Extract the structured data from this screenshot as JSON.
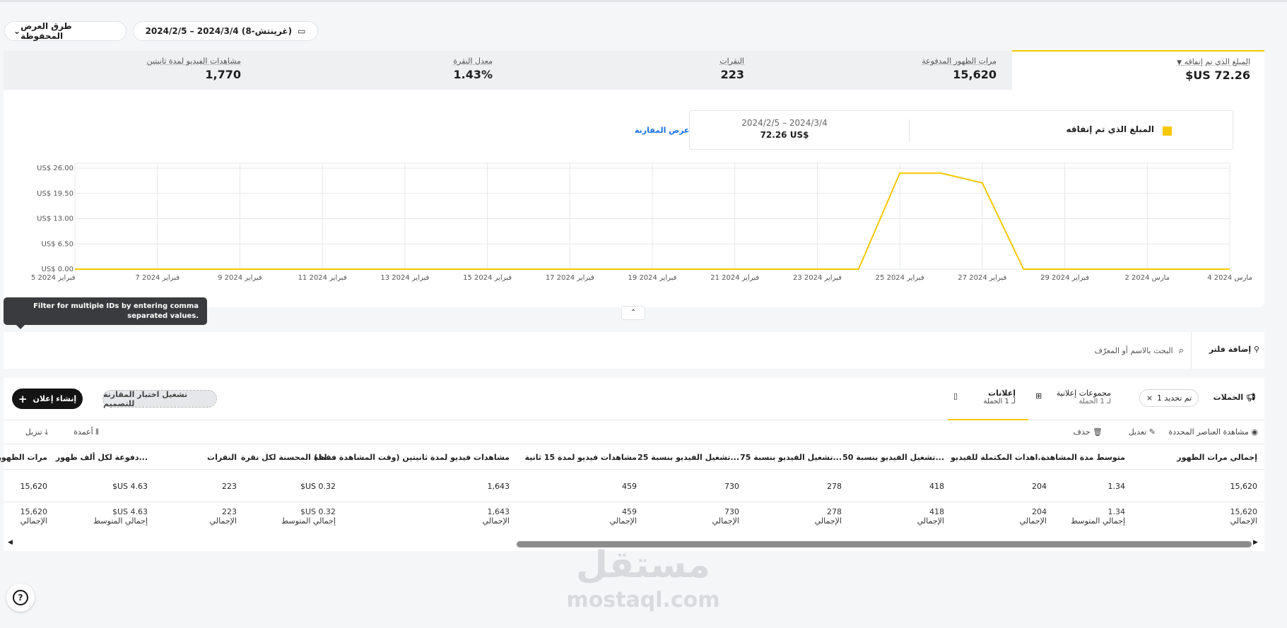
{
  "toolbar": {
    "saved_views_label": "طرق العرض المحفوظة",
    "date_range_label": "2024/2/5 – 2024/3/4 (غرينتش-8)"
  },
  "kpis": [
    {
      "label": "المبلغ الذي تم إنفاقه",
      "value": "72.26 US$"
    },
    {
      "label": "مرات الظهور المدفوعة",
      "value": "15,620"
    },
    {
      "label": "النقرات",
      "value": "223"
    },
    {
      "label": "معدل النقرة",
      "value": "1.43%"
    },
    {
      "label": "مشاهدات الفيديو لمدة ثانيتين",
      "value": "1,770"
    }
  ],
  "legend": {
    "metric": "المبلغ الذي تم إنفاقه",
    "range": "2024/2/5 – 2024/3/4",
    "value": "72.26 US$",
    "color": "#f6c800"
  },
  "compare_link": "عرض المقارنة",
  "chart_data": {
    "type": "line",
    "x": [
      "2024/2/5",
      "2024/2/6",
      "2024/2/7",
      "2024/2/8",
      "2024/2/9",
      "2024/2/10",
      "2024/2/11",
      "2024/2/12",
      "2024/2/13",
      "2024/2/14",
      "2024/2/15",
      "2024/2/16",
      "2024/2/17",
      "2024/2/18",
      "2024/2/19",
      "2024/2/20",
      "2024/2/21",
      "2024/2/22",
      "2024/2/23",
      "2024/2/24",
      "2024/2/25",
      "2024/2/26",
      "2024/2/27",
      "2024/2/28",
      "2024/2/29",
      "2024/3/1",
      "2024/3/2",
      "2024/3/3",
      "2024/3/4"
    ],
    "series": [
      {
        "values": [
          0,
          0,
          0,
          0,
          0,
          0,
          0,
          0,
          0,
          0,
          0,
          0,
          0,
          0,
          0,
          0,
          0,
          0,
          0,
          0,
          24.7,
          24.7,
          22.2,
          0,
          0,
          0,
          0,
          0,
          0
        ],
        "color": "#f6c800"
      }
    ],
    "yticks": [
      "US$ 0.00",
      "US$ 6.50",
      "US$ 13.00",
      "US$ 19.50",
      "US$ 26.00"
    ],
    "ylim": [
      0,
      26
    ],
    "xticks": [
      "5 فبراير 2024",
      "7 فبراير 2024",
      "9 فبراير 2024",
      "11 فبراير 2024",
      "13 فبراير 2024",
      "15 فبراير 2024",
      "17 فبراير 2024",
      "19 فبراير 2024",
      "21 فبراير 2024",
      "23 فبراير 2024",
      "25 فبراير 2024",
      "27 فبراير 2024",
      "29 فبراير 2024",
      "2 مارس 2024",
      "4 مارس 2024"
    ],
    "grid": true
  },
  "tooltip": "Filter for multiple IDs by entering comma separated values.",
  "filter": {
    "add_label": "إضافة فلتر",
    "search_placeholder": "البحث بالاسم أو المعرّف"
  },
  "tabs": {
    "campaigns": "الحملات",
    "selected_chip": "تم تحديد 1",
    "ad_groups": "مجموعات إعلانية",
    "ad_groups_sub": "لـ 1 الحملة",
    "ads": "إعلانات",
    "ads_sub": "لـ 1 الحملة",
    "ab_test": "تشغيل اختبار المقارنة للتصميم",
    "create_ad": "إنشاء إعلان"
  },
  "actions": {
    "view_selected": "مشاهدة العناصر المحددة",
    "edit": "تعديل",
    "delete": "حذف",
    "columns": "أعمدة",
    "download": "تنزيل"
  },
  "table": {
    "headers": [
      "إجمالي مرات الظهور",
      "متوسط مدة المشاهدة",
      "...اهدات المكتملة للفيديو",
      "...تشغيل الفيديو بنسبة 50",
      "...تشغيل الفيديو بنسبة 75",
      "...تشغيل الفيديو بنسبة 25",
      "مشاهدات فيديو لمدة 15 ثانية",
      "مشاهدات فيديو لمدة ثانيتين (وقت المشاهدة فقط)",
      "...لفة المحسنة لكل نقرة",
      "النقرات",
      "...دفوعة لكل ألف ظهور",
      "مرات الظهور"
    ],
    "row": [
      "15,620",
      "1.34",
      "204",
      "418",
      "278",
      "730",
      "459",
      "1,643",
      "0.32 US$",
      "223",
      "4.63 US$",
      "15,620"
    ],
    "totals": [
      "15,620",
      "1.34",
      "204",
      "418",
      "278",
      "730",
      "459",
      "1,643",
      "0.32 US$",
      "223",
      "4.63 US$",
      "15,620"
    ],
    "total_labels": [
      "الإجمالي",
      "إجمالي المتوسط",
      "الإجمالي",
      "الإجمالي",
      "الإجمالي",
      "الإجمالي",
      "الإجمالي",
      "الإجمالي",
      "إجمالي المتوسط",
      "الإجمالي",
      "إجمالي المتوسط",
      "الإجمالي"
    ]
  },
  "watermark": {
    "arabic": "مستقل",
    "latin": "mostaql.com"
  }
}
